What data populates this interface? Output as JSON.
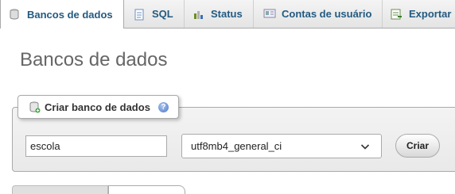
{
  "tabs": [
    {
      "label": "Bancos de dados",
      "icon": "database-icon",
      "active": true
    },
    {
      "label": "SQL",
      "icon": "sql-icon",
      "active": false
    },
    {
      "label": "Status",
      "icon": "status-icon",
      "active": false
    },
    {
      "label": "Contas de usuário",
      "icon": "user-accounts-icon",
      "active": false
    },
    {
      "label": "Exportar",
      "icon": "export-icon",
      "active": false
    }
  ],
  "page": {
    "title": "Bancos de dados"
  },
  "create_db": {
    "legend": "Criar banco de dados",
    "name_value": "escola",
    "collation_value": "utf8mb4_general_ci",
    "submit_label": "Criar"
  },
  "colors": {
    "tab_text": "#235a81",
    "title": "#666666",
    "panel_border": "#aaaaaa"
  }
}
